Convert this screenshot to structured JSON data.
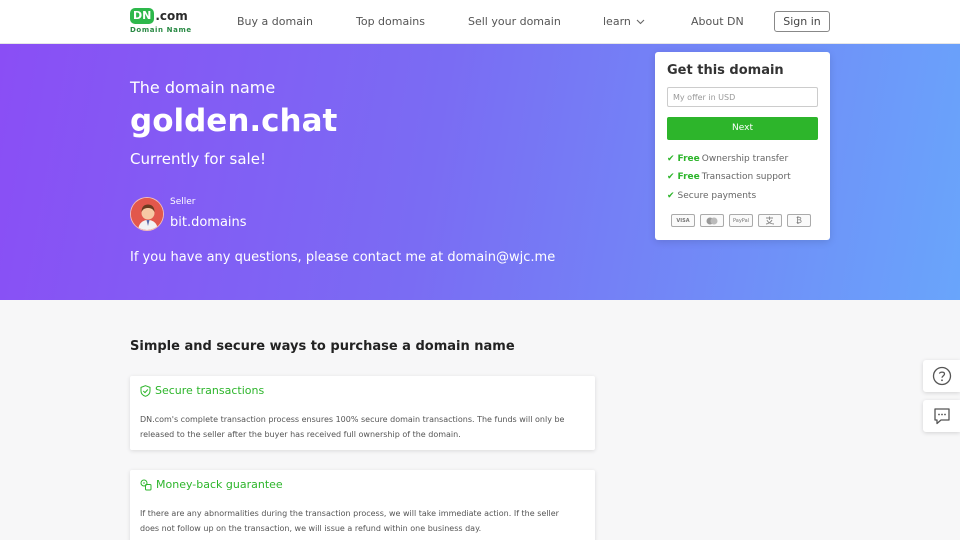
{
  "header": {
    "logo_brand": "DN",
    "logo_tld": ".com",
    "logo_sub": "Domain Name",
    "nav": [
      {
        "label": "Buy a domain"
      },
      {
        "label": "Top domains"
      },
      {
        "label": "Sell your domain"
      },
      {
        "label": "learn"
      },
      {
        "label": "About DN"
      }
    ],
    "sign_in": "Sign in"
  },
  "hero": {
    "pretitle": "The domain name",
    "domain": "golden.chat",
    "status": "Currently for sale!",
    "seller_label": "Seller",
    "seller_name": "bit.domains",
    "contact": "If you have any questions, please contact me at domain@wjc.me"
  },
  "purchase_card": {
    "title": "Get this domain",
    "offer_placeholder": "My offer in USD",
    "next_label": "Next",
    "features": [
      {
        "free": "Free",
        "text": "Ownership transfer"
      },
      {
        "free": "Free",
        "text": "Transaction support"
      },
      {
        "free": "",
        "text": "Secure payments"
      }
    ],
    "payment_methods": [
      "VISA",
      "",
      "PayPal",
      "",
      "₿"
    ]
  },
  "section": {
    "title": "Simple and secure ways to purchase a domain name",
    "cards": [
      {
        "icon": "shield-check-icon",
        "title": "Secure transactions",
        "body": "DN.com's complete transaction process ensures 100% secure domain transactions. The funds will only be released to the seller after the buyer has received full ownership of the domain."
      },
      {
        "icon": "money-back-icon",
        "title": "Money-back guarantee",
        "body": "If there are any abnormalities during the transaction process, we will take immediate action. If the seller does not follow up on the transaction, we will issue a refund within one business day."
      }
    ]
  },
  "side_buttons": [
    "help-icon",
    "chat-icon"
  ],
  "colors": {
    "brand_green": "#2db52b",
    "hero_gradient_start": "#8a4ef5",
    "hero_gradient_end": "#69a5fb"
  }
}
